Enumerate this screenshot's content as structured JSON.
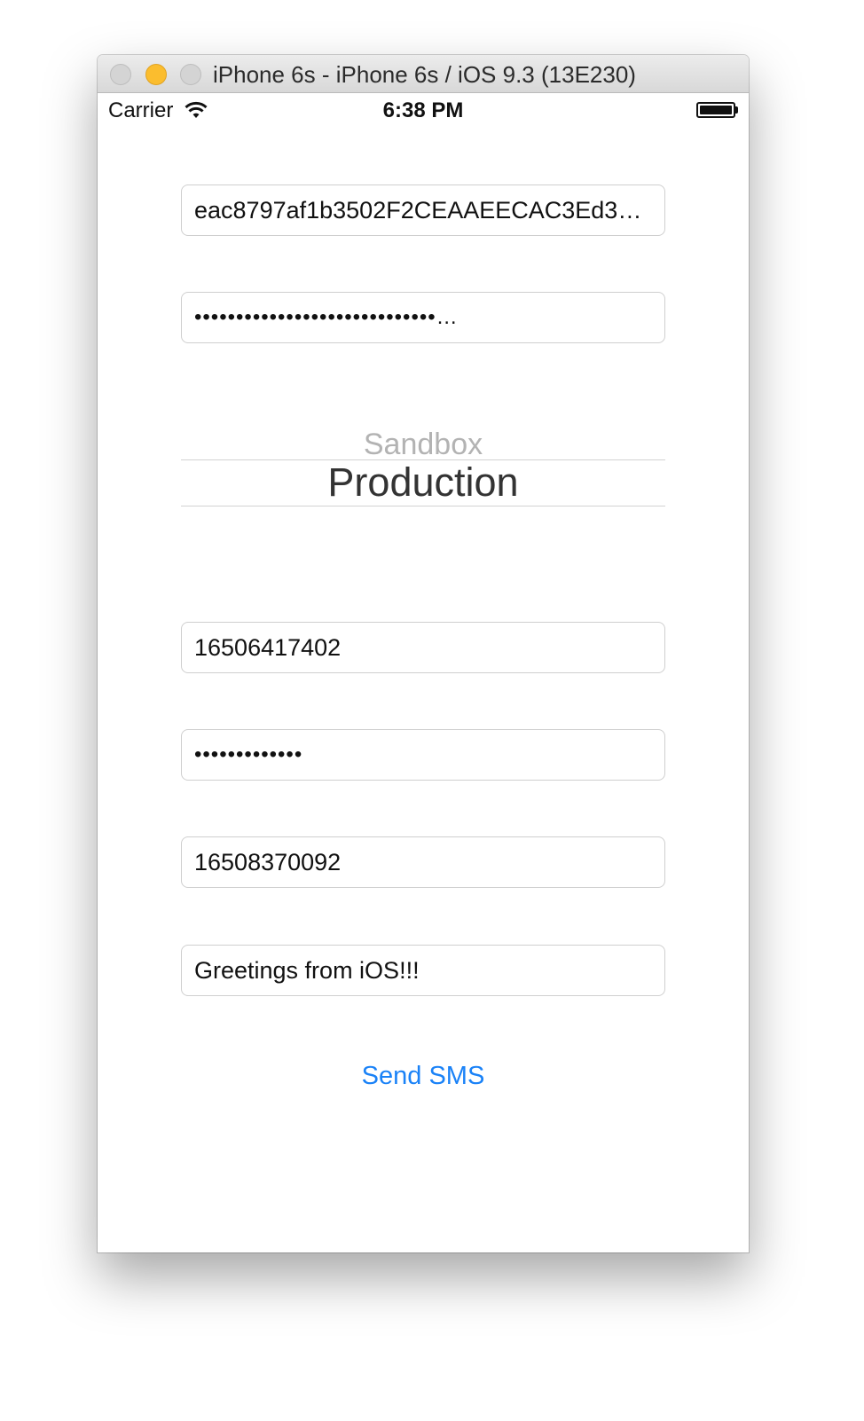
{
  "window": {
    "title": "iPhone 6s - iPhone 6s / iOS 9.3 (13E230)"
  },
  "status_bar": {
    "carrier": "Carrier",
    "time": "6:38 PM",
    "icons": [
      "wifi-icon",
      "battery-icon"
    ]
  },
  "form": {
    "app_key_value": "eac8797af1b3502F2CEAAEECAC3Ed3…",
    "app_secret_value": "•••••••••••••••••••••••••••••…",
    "environment_picker": {
      "options": [
        "Sandbox",
        "Production"
      ],
      "selected": "Production"
    },
    "username_value": "16506417402",
    "password_value": "•••••••••••••",
    "to_number_value": "16508370092",
    "message_value": "Greetings from iOS!!!",
    "send_label": "Send SMS"
  },
  "colors": {
    "accent": "#1a82f7",
    "minimize_button": "#fbbd2e"
  }
}
